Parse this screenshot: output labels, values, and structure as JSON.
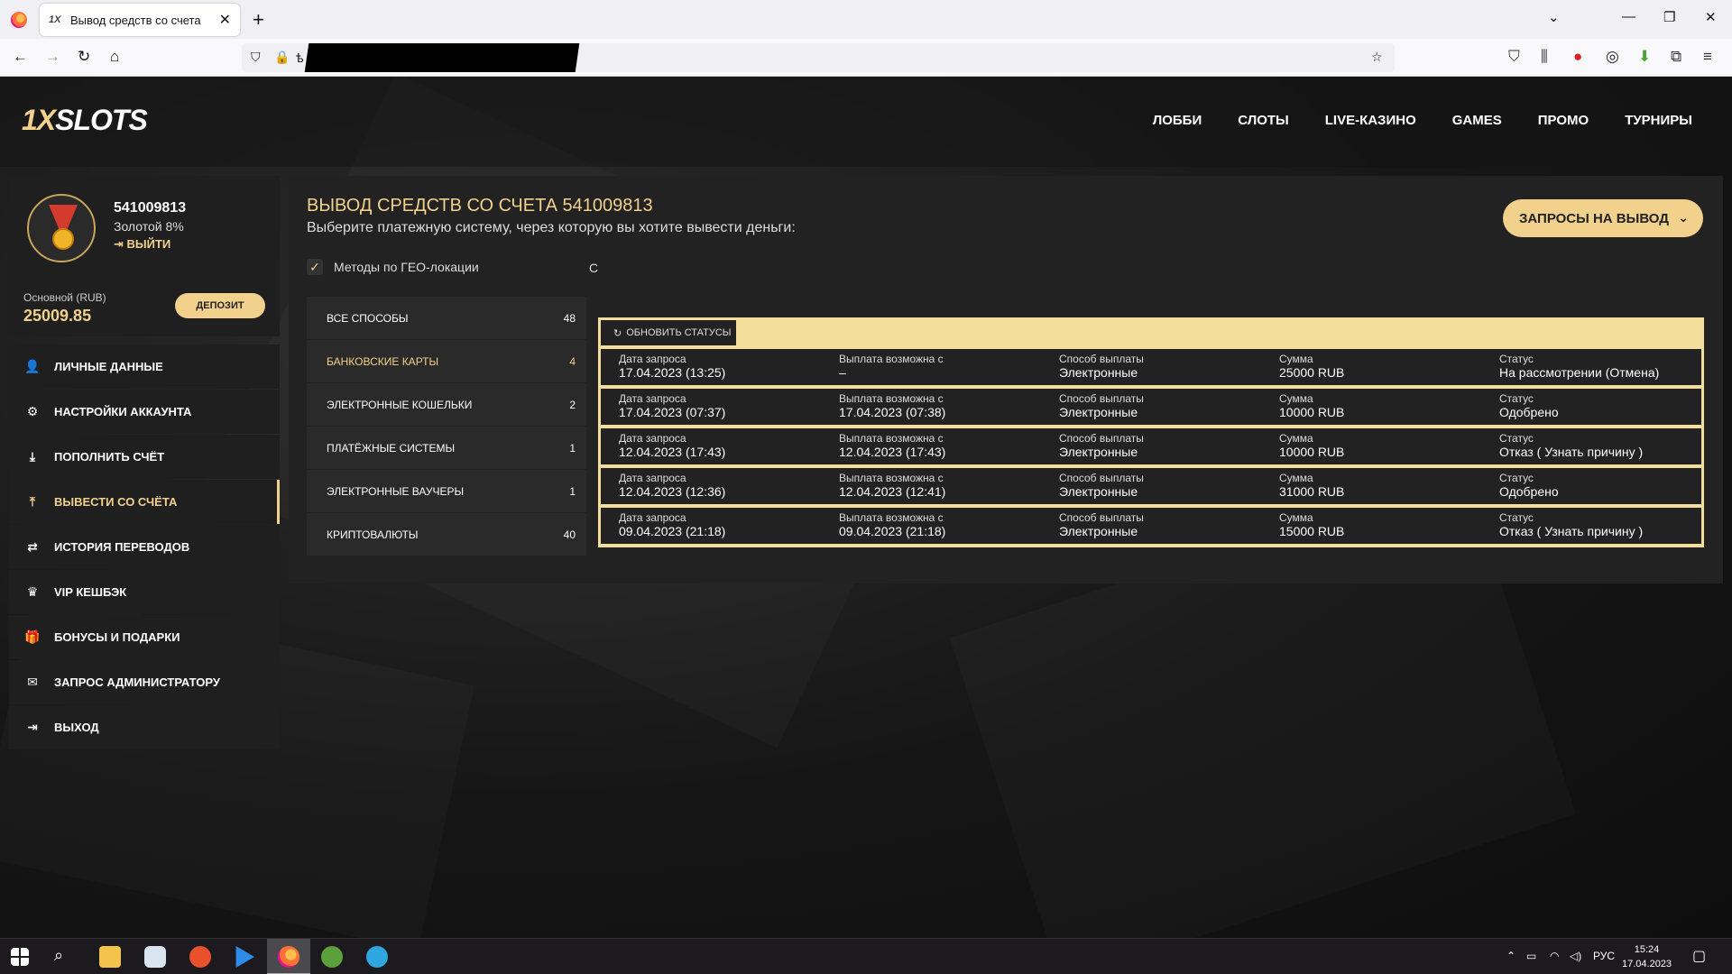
{
  "browser": {
    "tab_title": "Вывод средств со счета",
    "tab_favicon": "1X",
    "url_prefix": "ѣ"
  },
  "site": {
    "logo_main": "1X",
    "logo_rest": "SLOTS",
    "nav": [
      "ЛОББИ",
      "СЛОТЫ",
      "LIVE-КАЗИНО",
      "GAMES",
      "ПРОМО",
      "ТУРНИРЫ"
    ]
  },
  "profile": {
    "account_id": "541009813",
    "level": "Золотой 8%",
    "logout": "ВЫЙТИ",
    "balance_label": "Основной (RUB)",
    "balance": "25009.85",
    "deposit": "ДЕПОЗИТ"
  },
  "sidemenu": [
    {
      "label": "ЛИЧНЫЕ ДАННЫЕ",
      "icon": "user-plus-icon",
      "glyph": "👤"
    },
    {
      "label": "НАСТРОЙКИ АККАУНТА",
      "icon": "gears-icon",
      "glyph": "⚙"
    },
    {
      "label": "ПОПОЛНИТЬ СЧЁТ",
      "icon": "download-icon",
      "glyph": "⤓"
    },
    {
      "label": "ВЫВЕСТИ СО СЧЁТА",
      "icon": "upload-icon",
      "glyph": "⤒"
    },
    {
      "label": "ИСТОРИЯ ПЕРЕВОДОВ",
      "icon": "exchange-icon",
      "glyph": "⇄"
    },
    {
      "label": "VIP КЕШБЭК",
      "icon": "crown-icon",
      "glyph": "♛"
    },
    {
      "label": "БОНУСЫ И ПОДАРКИ",
      "icon": "gift-icon",
      "glyph": "🎁"
    },
    {
      "label": "ЗАПРОС АДМИНИСТРАТОРУ",
      "icon": "envelope-icon",
      "glyph": "✉"
    },
    {
      "label": "ВЫХОД",
      "icon": "sign-out-icon",
      "glyph": "⇥"
    }
  ],
  "main": {
    "title": "ВЫВОД СРЕДСТВ СО СЧЕТА 541009813",
    "subtitle": "Выберите платежную систему, через которую вы хотите вывести деньги:",
    "requests_button": "ЗАПРОСЫ НА ВЫВОД",
    "geo_label": "Методы по ГЕО-локации",
    "cut_letter": "С",
    "methods": [
      {
        "label": "ВСЕ СПОСОБЫ",
        "count": "48"
      },
      {
        "label": "БАНКОВСКИЕ КАРТЫ",
        "count": "4"
      },
      {
        "label": "ЭЛЕКТРОННЫЕ КОШЕЛЬКИ",
        "count": "2"
      },
      {
        "label": "ПЛАТЁЖНЫЕ СИСТЕМЫ",
        "count": "1"
      },
      {
        "label": "ЭЛЕКТРОННЫЕ ВАУЧЕРЫ",
        "count": "1"
      },
      {
        "label": "КРИПТОВАЛЮТЫ",
        "count": "40"
      }
    ]
  },
  "requests": {
    "refresh": "ОБНОВИТЬ СТАТУСЫ",
    "labels": [
      "Дата запроса",
      "Выплата возможна с",
      "Способ выплаты",
      "Сумма",
      "Статус"
    ],
    "rows": [
      [
        "17.04.2023 (13:25)",
        "–",
        "Электронные",
        "25000 RUB",
        "На рассмотрении (Отмена)"
      ],
      [
        "17.04.2023 (07:37)",
        "17.04.2023 (07:38)",
        "Электронные",
        "10000 RUB",
        "Одобрено"
      ],
      [
        "12.04.2023 (17:43)",
        "12.04.2023 (17:43)",
        "Электронные",
        "10000 RUB",
        "Отказ ( Узнать причину )"
      ],
      [
        "12.04.2023 (12:36)",
        "12.04.2023 (12:41)",
        "Электронные",
        "31000 RUB",
        "Одобрено"
      ],
      [
        "09.04.2023 (21:18)",
        "09.04.2023 (21:18)",
        "Электронные",
        "15000 RUB",
        "Отказ ( Узнать причину )"
      ]
    ]
  },
  "taskbar": {
    "lang": "РУС",
    "time": "15:24",
    "date": "17.04.2023"
  },
  "colors": {
    "accent": "#f2d18c",
    "panel": "#222222",
    "dropdown_bg": "#f5dd9b"
  }
}
